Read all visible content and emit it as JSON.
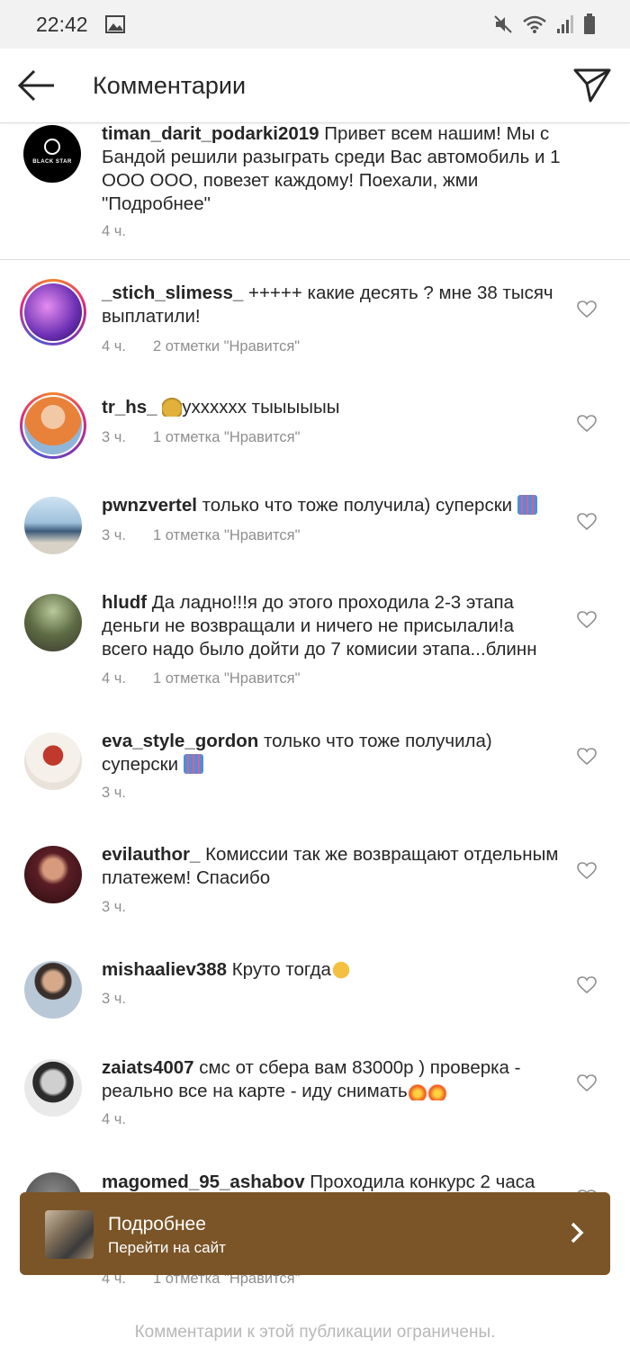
{
  "statusbar": {
    "time": "22:42"
  },
  "appbar": {
    "title": "Комментарии"
  },
  "caption": {
    "user": "timan_darit_podarki2019",
    "text": " Привет всем нашим! Мы с Бандой решили разыграть среди Вас автомобиль и 1 ООО ООО, повезет каждому! Поехали, жми \"Подробнее\"",
    "time": "4 ч.",
    "avatar_label": "BLACK STAR"
  },
  "comments": [
    {
      "user": "_stich_slimess_",
      "text": " +++++ какие десять ? мне 38 тысяч выплатили!",
      "time": "4 ч.",
      "likes": "2 отметки \"Нравится\""
    },
    {
      "user": "tr_hs_",
      "text": "ухххххх тыыыыыы",
      "time": "3 ч.",
      "likes": "1 отметка \"Нравится\""
    },
    {
      "user": "pwnzvertel",
      "text": " только что тоже получила) суперски ",
      "time": "3 ч.",
      "likes": "1 отметка \"Нравится\""
    },
    {
      "user": "hludf",
      "text": " Да ладно!!!я до этого проходила 2-3 этапа деньги не возвращали и ничего не присылали!а всего надо было дойти до 7 комисии этапа...блинн",
      "time": "4 ч.",
      "likes": "1 отметка \"Нравится\""
    },
    {
      "user": "eva_style_gordon",
      "text": " только что тоже получила) суперски ",
      "time": "3 ч.",
      "likes": ""
    },
    {
      "user": "evilauthor_",
      "text": " Комиссии так же возвращают отдельным платежем! Спасибо",
      "time": "3 ч.",
      "likes": ""
    },
    {
      "user": "mishaaliev388",
      "text": " Круто тогда",
      "time": "3 ч.",
      "likes": ""
    },
    {
      "user": "zaiats4007",
      "text": " смс от сбера вам 83000р ) проверка - реально все на карте - иду снимать",
      "time": "4 ч.",
      "likes": ""
    },
    {
      "user": "magomed_95_ashabov",
      "text": " Проходила конкурс 2 часа",
      "time": "4 ч.",
      "likes": "1 отметка \"Нравится\""
    }
  ],
  "cta": {
    "title": "Подробнее",
    "subtitle": "Перейти на сайт"
  },
  "footer": {
    "note": "Комментарии к этой публикации ограничены."
  },
  "colors": {
    "cta_bg": "#7b5527",
    "meta": "#8e8e8e",
    "divider": "#dbdbdb"
  }
}
